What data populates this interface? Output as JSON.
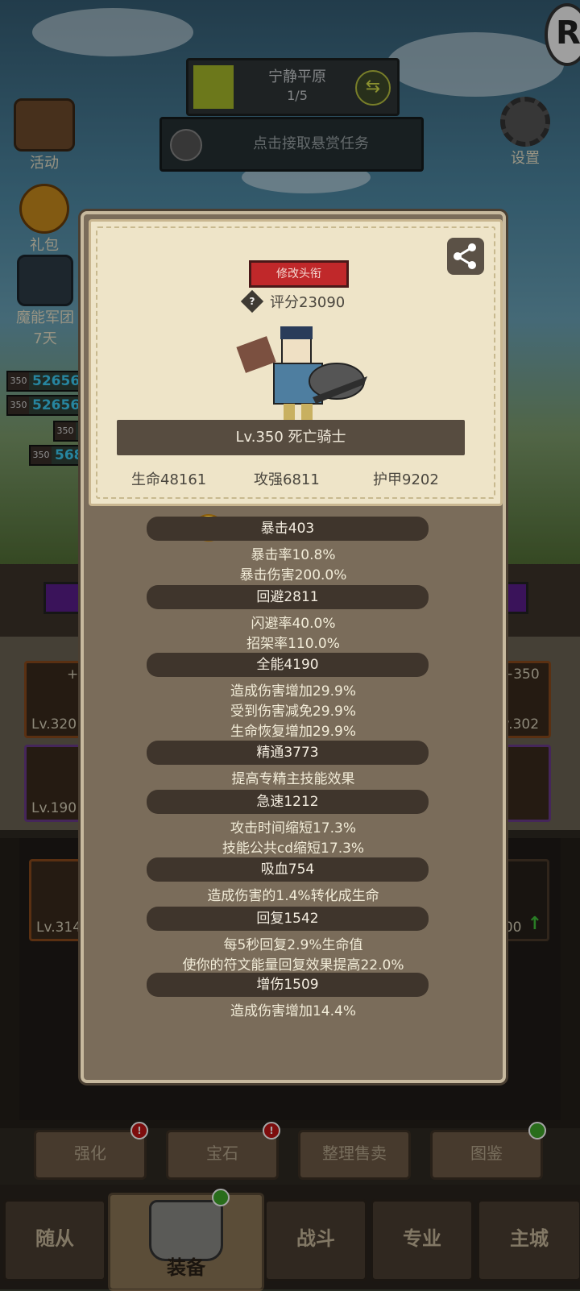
{
  "top": {
    "stage_name": "宁静平原",
    "stage_progress": "1/5",
    "quest_text": "点击接取悬赏任务",
    "settings_label": "设置"
  },
  "left_menu": {
    "activity_label": "活动",
    "gift_label": "礼包",
    "legion_label": "魔能军团",
    "legion_days": "7天"
  },
  "enemy_bars": [
    {
      "level": "350",
      "value": "52656"
    },
    {
      "level": "350",
      "value": "52656"
    },
    {
      "level": "350",
      "value": ""
    },
    {
      "level": "350",
      "value": "568"
    }
  ],
  "equipment_slots": [
    {
      "plus": "+3",
      "level": "Lv.320"
    },
    {
      "plus": "+350",
      "level": "Lv.302"
    },
    {
      "plus": "",
      "level": "Lv.190"
    },
    {
      "plus": "",
      "level": "Lv.314"
    },
    {
      "plus": "",
      "level": "300"
    }
  ],
  "popup": {
    "change_title_button": "修改头衔",
    "score": "评分23090",
    "hero_name": "Lv.350 死亡骑士",
    "hp": "生命48161",
    "attack": "攻强6811",
    "armor": "护甲9202",
    "attributes": [
      {
        "title": "暴击403",
        "lines": [
          "暴击率10.8%",
          "暴击伤害200.0%"
        ]
      },
      {
        "title": "回避2811",
        "lines": [
          "闪避率40.0%",
          "招架率110.0%"
        ]
      },
      {
        "title": "全能4190",
        "lines": [
          "造成伤害增加29.9%",
          "受到伤害减免29.9%",
          "生命恢复增加29.9%"
        ]
      },
      {
        "title": "精通3773",
        "lines": [
          "提高专精主技能效果"
        ]
      },
      {
        "title": "急速1212",
        "lines": [
          "攻击时间缩短17.3%",
          "技能公共cd缩短17.3%"
        ]
      },
      {
        "title": "吸血754",
        "lines": [
          "造成伤害的1.4%转化成生命"
        ]
      },
      {
        "title": "回复1542",
        "lines": [
          "每5秒回复2.9%生命值",
          "使你的符文能量回复效果提高22.0%"
        ]
      },
      {
        "title": "增伤1509",
        "lines": [
          "造成伤害增加14.4%"
        ]
      }
    ]
  },
  "action_buttons": [
    "强化",
    "宝石",
    "整理售卖",
    "图鉴"
  ],
  "bottom_nav": [
    "随从",
    "装备",
    "战斗",
    "专业",
    "主城"
  ],
  "colors": {
    "title_button_red": "#c0282a",
    "popup_bg": "#7a6c5a",
    "card_bg": "#eee4c8",
    "enemy_hp_text": "#3ccdf5"
  }
}
